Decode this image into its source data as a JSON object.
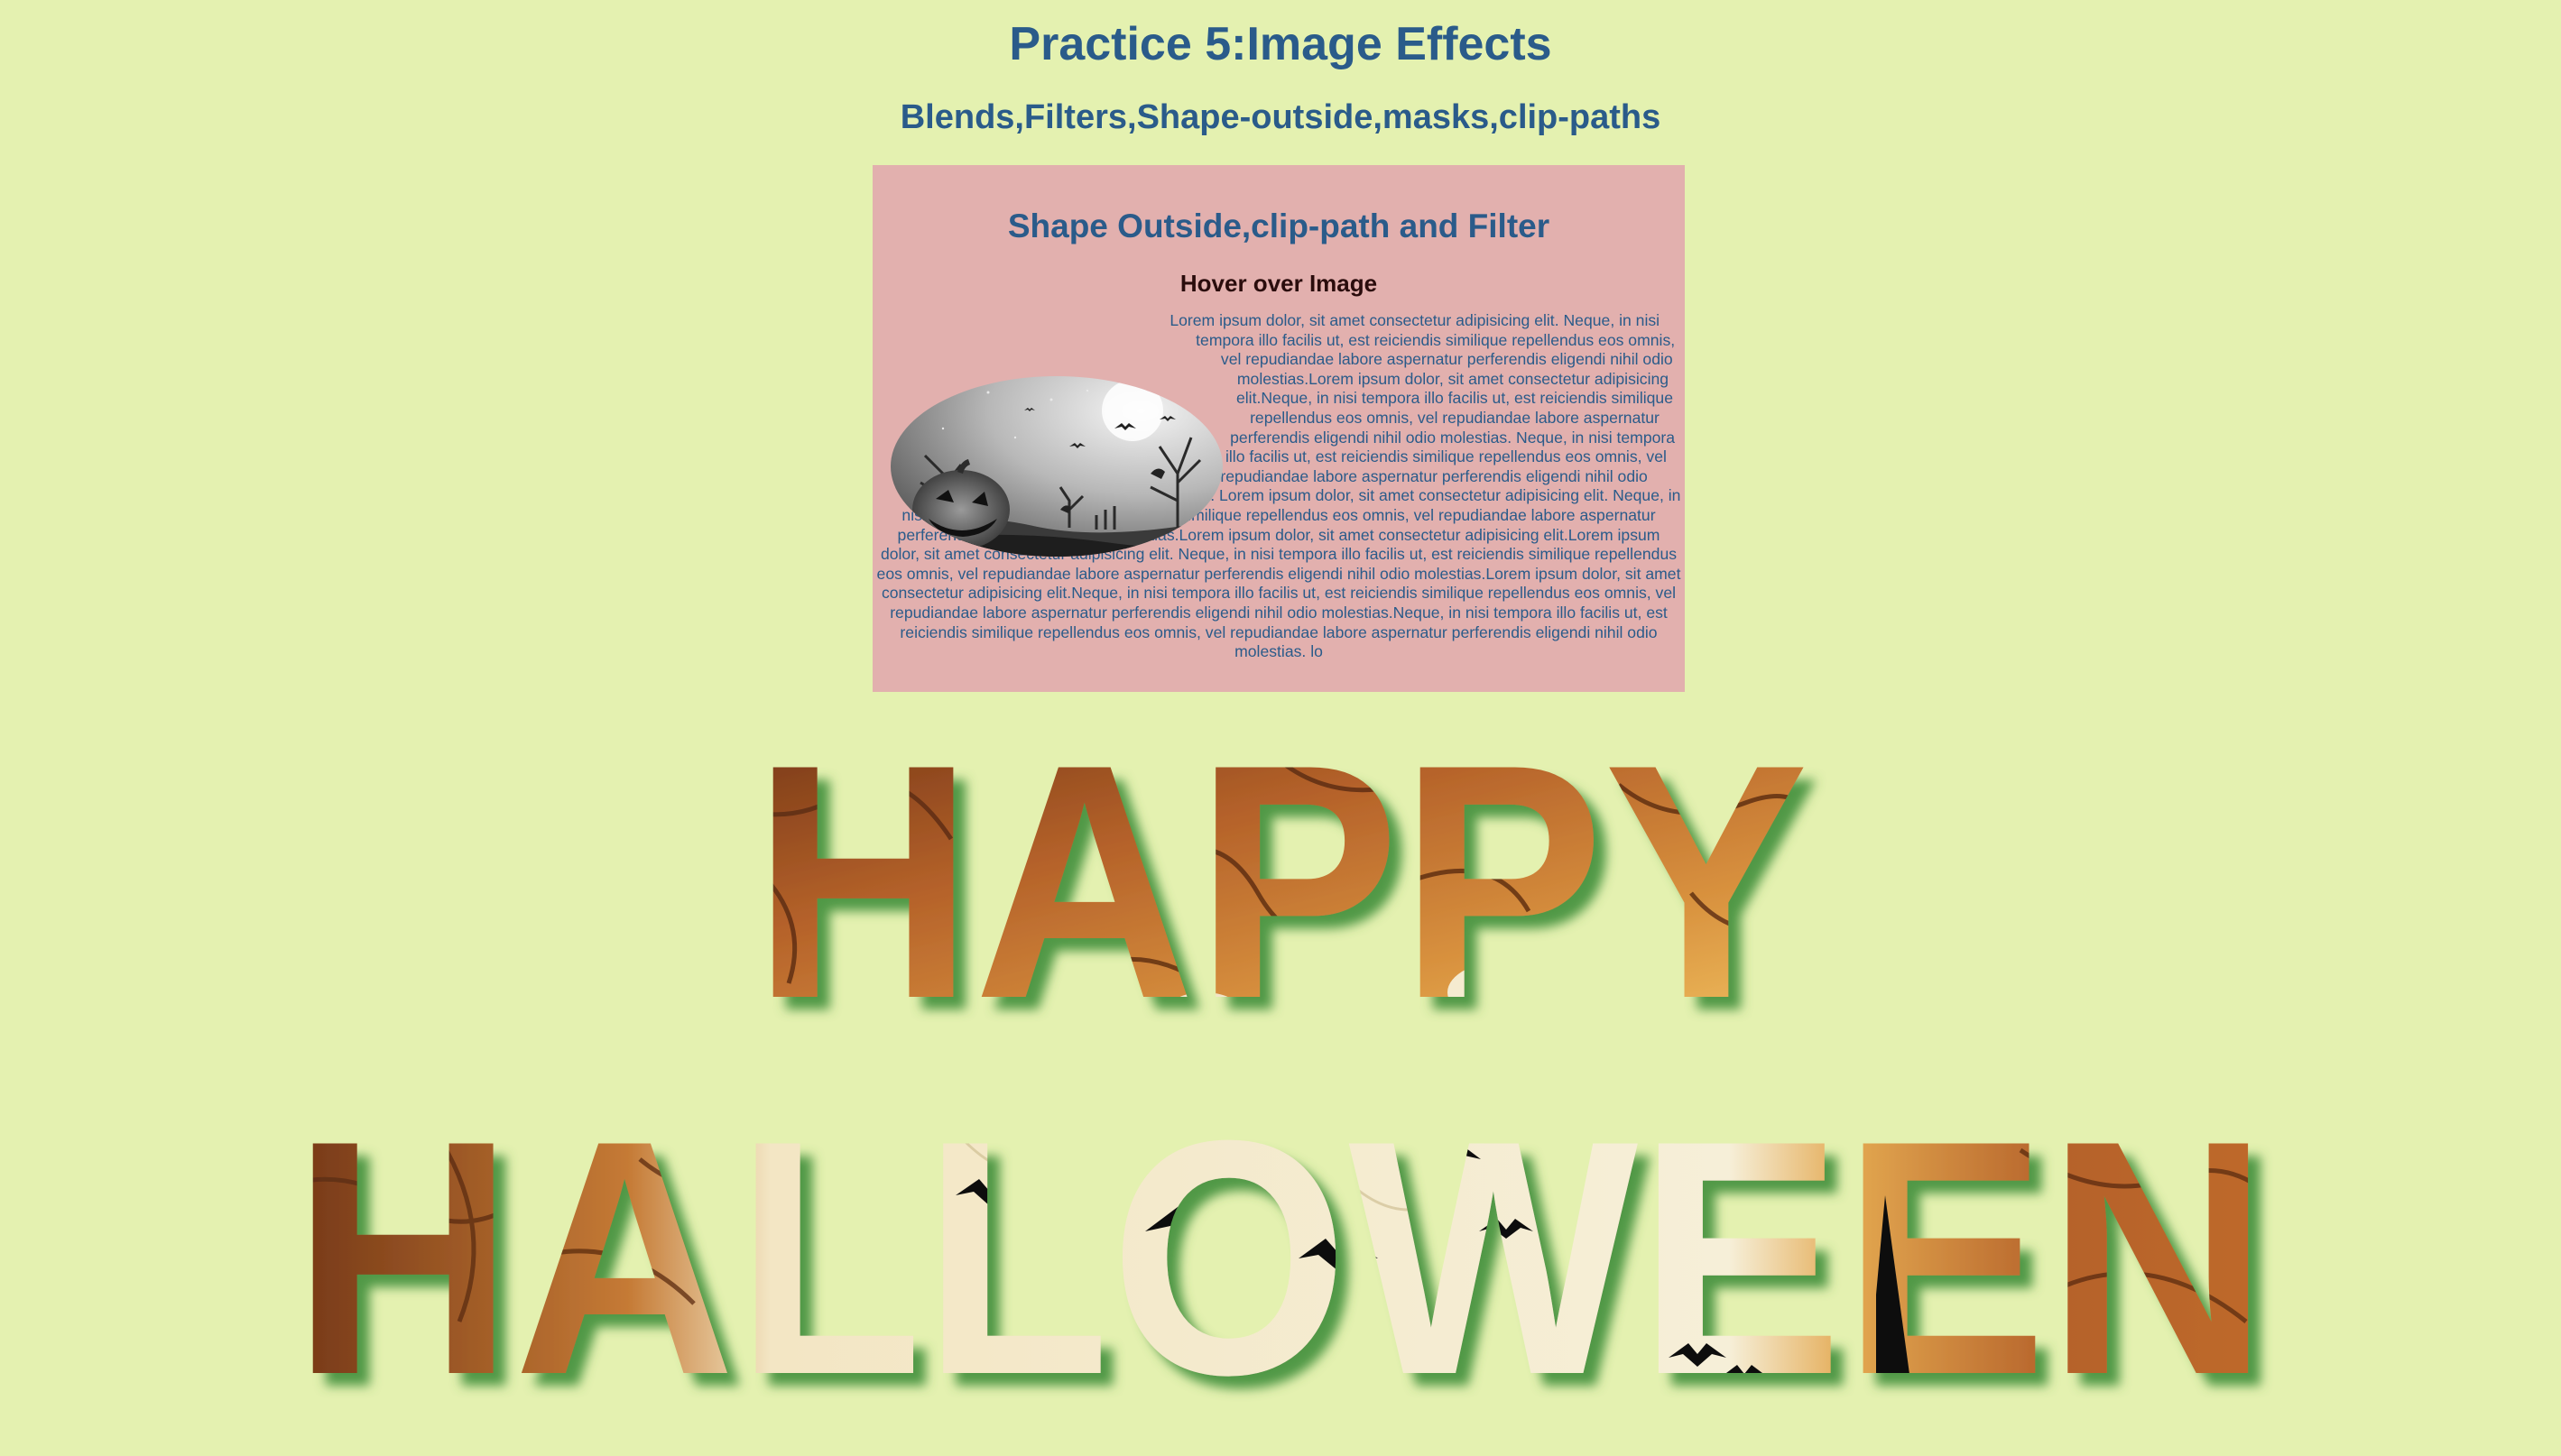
{
  "page": {
    "title": "Practice 5:Image Effects",
    "subtitle": "Blends,Filters,Shape-outside,masks,clip-paths"
  },
  "card": {
    "title": "Shape Outside,clip-path and Filter",
    "hint": "Hover over Image",
    "body": "Lorem ipsum dolor, sit amet consectetur adipisicing elit. Neque, in nisi tempora illo facilis ut, est reiciendis similique repellendus eos omnis, vel repudiandae labore aspernatur perferendis eligendi nihil odio molestias.Lorem ipsum dolor, sit amet consectetur adipisicing elit.Neque, in nisi tempora illo facilis ut, est reiciendis similique repellendus eos omnis, vel repudiandae labore aspernatur perferendis eligendi nihil odio molestias. Neque, in nisi tempora illo facilis ut, est reiciendis similique repellendus eos omnis, vel repudiandae labore aspernatur perferendis eligendi nihil odio molestias. Lorem ipsum dolor, sit amet consectetur adipisicing elit. Neque, in nisi tempora illo facilis ut, est reiciendis similique repellendus eos omnis, vel repudiandae labore aspernatur perferendis eligendi nihil odio molestias.Lorem ipsum dolor, sit amet consectetur adipisicing elit.Lorem ipsum dolor, sit amet consectetur adipisicing elit. Neque, in nisi tempora illo facilis ut, est reiciendis similique repellendus eos omnis, vel repudiandae labore aspernatur perferendis eligendi nihil odio molestias.Lorem ipsum dolor, sit amet consectetur adipisicing elit.Neque, in nisi tempora illo facilis ut, est reiciendis similique repellendus eos omnis, vel repudiandae labore aspernatur perferendis eligendi nihil odio molestias.Neque, in nisi tempora illo facilis ut, est reiciendis similique repellendus eos omnis, vel repudiandae labore aspernatur perferendis eligendi nihil odio molestias. lo",
    "image_icon": "halloween-pumpkin-image"
  },
  "banner": {
    "line1": "HAPPY",
    "line2": "HALLOWEEN"
  },
  "colors": {
    "background": "#e4f1b0",
    "heading": "#2a5b8a",
    "card_bg": "#e2b0ae",
    "hint": "#2a0c0c",
    "letter_orange": "#c06a2a",
    "letter_cream": "#f6efd8",
    "shadow_green": "#3f8f3a"
  }
}
